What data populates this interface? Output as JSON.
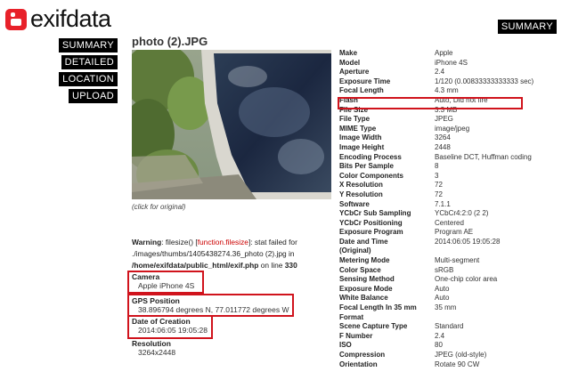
{
  "logo": {
    "text": "exifdata"
  },
  "summary_top": "SUMMARY",
  "nav": [
    "SUMMARY",
    "DETAILED",
    "LOCATION",
    "UPLOAD"
  ],
  "photo": {
    "title": "photo (2).JPG",
    "caption": "(click for original)"
  },
  "warning": {
    "label": "Warning",
    "text1": ": filesize() [",
    "func": "function.filesize",
    "text2": "]: stat failed for ./images/thumbs/1405438274.36_photo (2).jpg in",
    "path": "/home/exifdata/public_html/exif.php",
    "text3": " on line ",
    "line": "330"
  },
  "left_info": [
    {
      "label": "Camera",
      "value": "Apple iPhone 4S"
    },
    {
      "label": "GPS Position",
      "value": "38.896794 degrees N, 77.011772 degrees W"
    },
    {
      "label": "Date of Creation",
      "value": "2014:06:05 19:05:28"
    },
    {
      "label": "Resolution",
      "value": "3264x2448"
    }
  ],
  "exif": [
    [
      "Make",
      "Apple"
    ],
    [
      "Model",
      "iPhone 4S"
    ],
    [
      "Aperture",
      "2.4"
    ],
    [
      "Exposure Time",
      "1/120 (0.00833333333333 sec)"
    ],
    [
      "Focal Length",
      "4.3 mm"
    ],
    [
      "Flash",
      "Auto, Did not fire"
    ],
    [
      "File Size",
      "3.3 MB"
    ],
    [
      "File Type",
      "JPEG"
    ],
    [
      "MIME Type",
      "image/jpeg"
    ],
    [
      "Image Width",
      "3264"
    ],
    [
      "Image Height",
      "2448"
    ],
    [
      "Encoding Process",
      "Baseline DCT, Huffman coding"
    ],
    [
      "Bits Per Sample",
      "8"
    ],
    [
      "Color Components",
      "3"
    ],
    [
      "X Resolution",
      "72"
    ],
    [
      "Y Resolution",
      "72"
    ],
    [
      "Software",
      "7.1.1"
    ],
    [
      "YCbCr Sub Sampling",
      "YCbCr4:2:0 (2 2)"
    ],
    [
      "YCbCr Positioning",
      "Centered"
    ],
    [
      "Exposure Program",
      "Program AE"
    ],
    [
      "Date and Time",
      "2014:06:05 19:05:28"
    ],
    [
      "(Original)",
      ""
    ],
    [
      "Metering Mode",
      "Multi-segment"
    ],
    [
      "Color Space",
      "sRGB"
    ],
    [
      "Sensing Method",
      "One-chip color area"
    ],
    [
      "Exposure Mode",
      "Auto"
    ],
    [
      "White Balance",
      "Auto"
    ],
    [
      "Focal Length In 35 mm",
      "35 mm"
    ],
    [
      "Format",
      ""
    ],
    [
      "Scene Capture Type",
      "Standard"
    ],
    [
      "F Number",
      "2.4"
    ],
    [
      "ISO",
      "80"
    ],
    [
      "Compression",
      "JPEG (old-style)"
    ],
    [
      "Orientation",
      "Rotate 90 CW"
    ]
  ],
  "colors": {
    "highlight": "#d0131c",
    "nav_bg": "#000000",
    "logo": "#e8212a",
    "error": "#cc0000"
  }
}
